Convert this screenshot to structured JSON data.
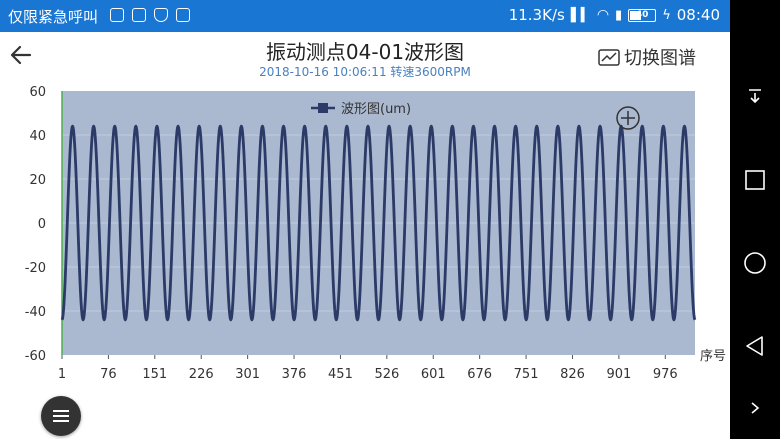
{
  "status_bar": {
    "carrier": "仅限紧急呼叫",
    "network_speed": "11.3K/s",
    "battery": "40",
    "time": "08:40"
  },
  "header": {
    "title": "振动测点04-01波形图",
    "subtitle": "2018-10-16 10:06:11 转速3600RPM",
    "switch_label": "切换图谱"
  },
  "colors": {
    "status_bar": "#1976d2",
    "plot_background": "#aab8d0",
    "series": "#2b3a66",
    "axis": "#4caf50"
  },
  "chart_data": {
    "type": "line",
    "legend": {
      "label": "波形图(um)",
      "position": "top-center"
    },
    "xlabel": "序号",
    "ylabel": "",
    "x_ticks": [
      1,
      76,
      151,
      226,
      301,
      376,
      451,
      526,
      601,
      676,
      751,
      826,
      901,
      976
    ],
    "y_ticks": [
      60,
      40,
      20,
      0,
      -20,
      -40,
      -60
    ],
    "xlim": [
      1,
      1024
    ],
    "ylim": [
      -60,
      60
    ],
    "grid": "horizontal",
    "series": [
      {
        "name": "波形图(um)",
        "waveform": "sine",
        "amplitude": 44,
        "offset": 0,
        "cycles": 30,
        "start_value": -44,
        "end_value": -44
      }
    ]
  }
}
